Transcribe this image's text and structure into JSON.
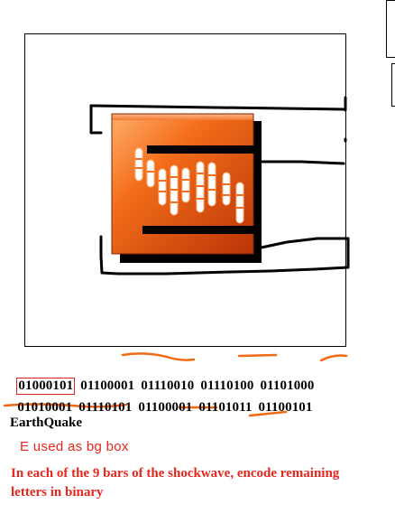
{
  "binary": {
    "row1": [
      "01000101",
      "01100001",
      "01110010",
      "01110100",
      "01101000"
    ],
    "row2": [
      "01010001",
      "01110101",
      "01100001",
      "01101011",
      "01100101"
    ]
  },
  "word": "EarthQuake",
  "notes": {
    "bg_box": "E used as bg box",
    "bars": "In each of the 9 bars of the shockwave, encode remaining letters in binary"
  },
  "colors": {
    "annotation": "#e8261d",
    "underline": "#f06a14",
    "box_light": "#f36d1b",
    "box_dark": "#c03a08",
    "shadow": "#000000"
  },
  "icon": {
    "name": "orange-box-icon",
    "bars": 9
  }
}
